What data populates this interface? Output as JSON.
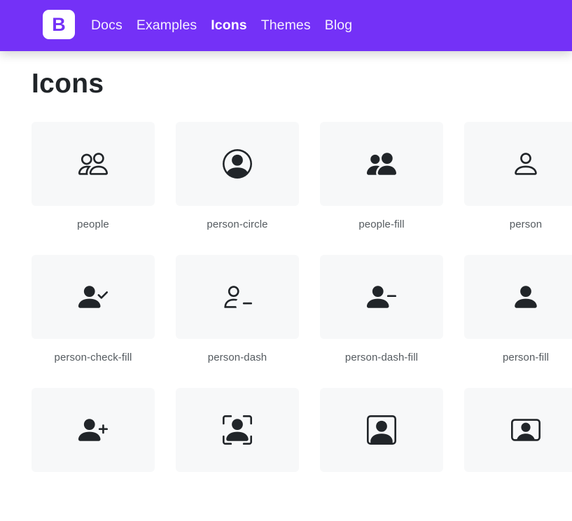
{
  "nav": {
    "brand": "B",
    "links": [
      "Docs",
      "Examples",
      "Icons",
      "Themes",
      "Blog"
    ],
    "active": "Icons"
  },
  "page": {
    "title": "Icons"
  },
  "icons": [
    {
      "name": "people",
      "icon": "people-icon"
    },
    {
      "name": "person-circle",
      "icon": "person-circle-icon"
    },
    {
      "name": "people-fill",
      "icon": "people-fill-icon"
    },
    {
      "name": "person",
      "icon": "person-icon"
    },
    {
      "name": "person-check-fill",
      "icon": "person-check-fill-icon"
    },
    {
      "name": "person-dash",
      "icon": "person-dash-icon"
    },
    {
      "name": "person-dash-fill",
      "icon": "person-dash-fill-icon"
    },
    {
      "name": "person-fill",
      "icon": "person-fill-icon"
    },
    {
      "name": "",
      "icon": "person-plus-fill-icon"
    },
    {
      "name": "",
      "icon": "person-bounding-box-icon"
    },
    {
      "name": "",
      "icon": "person-square-icon"
    },
    {
      "name": "",
      "icon": "person-video-icon"
    }
  ],
  "colors": {
    "navbar": "#7431f7",
    "tile": "#f7f8f9",
    "icon": "#212529",
    "label": "#555b60"
  }
}
